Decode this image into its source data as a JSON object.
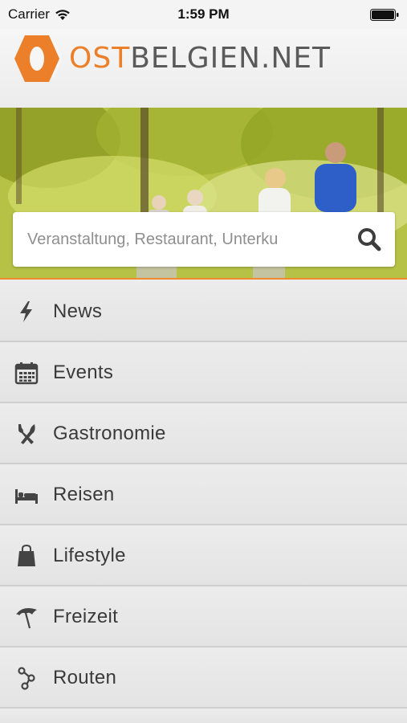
{
  "status_bar": {
    "carrier": "Carrier",
    "time": "1:59 PM"
  },
  "header": {
    "logo_ost": "OST",
    "logo_rest": "BELGIEN.NET",
    "brand_color": "#ec7f2a"
  },
  "search": {
    "placeholder": "Veranstaltung, Restaurant, Unterku",
    "icon": "search-icon"
  },
  "menu": {
    "items": [
      {
        "label": "News",
        "icon": "lightning-icon"
      },
      {
        "label": "Events",
        "icon": "calendar-icon"
      },
      {
        "label": "Gastronomie",
        "icon": "cutlery-icon"
      },
      {
        "label": "Reisen",
        "icon": "bed-icon"
      },
      {
        "label": "Lifestyle",
        "icon": "shopping-bag-icon"
      },
      {
        "label": "Freizeit",
        "icon": "umbrella-icon"
      },
      {
        "label": "Routen",
        "icon": "route-icon"
      }
    ]
  },
  "colors": {
    "accent": "#ec7f2a",
    "menu_text": "#3a3a3a",
    "icon": "#444444"
  }
}
